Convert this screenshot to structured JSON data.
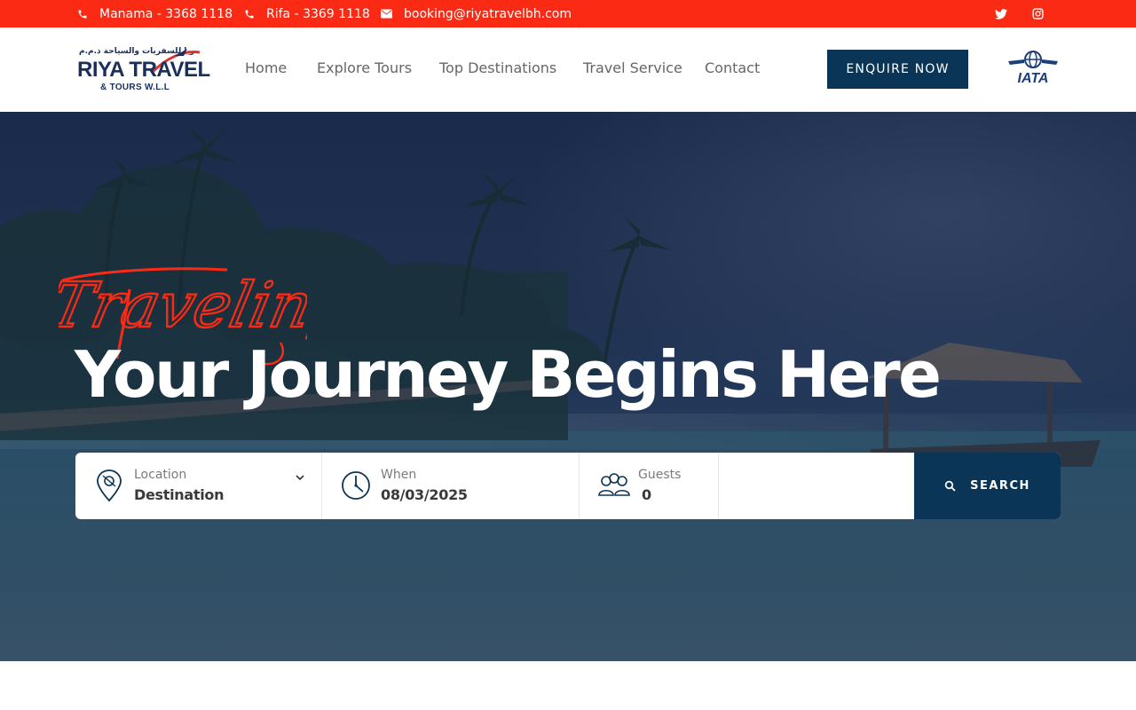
{
  "topbar": {
    "bg_color": "#fb2a14",
    "phone_manama": "Manama - 3368 1118",
    "phone_rifa": "Rifa - 3369 1118",
    "email": "booking@riyatravelbh.com",
    "social": [
      "twitter-icon",
      "instagram-icon"
    ]
  },
  "header": {
    "logo_arabic": "ريا للسفريات والسياحة ذ.م.م",
    "logo_main": "RIYA TRAVEL",
    "logo_sub": "& TOURS W.L.L",
    "nav": [
      "Home",
      "Explore Tours",
      "Top Destinations",
      "Travel Service",
      "Contact"
    ],
    "enquire_label": "ENQUIRE NOW",
    "iata_label": "IATA",
    "brand_color": "#0b3556"
  },
  "hero": {
    "script_title": "Traveling",
    "script_color": "#fb2a14",
    "headline": "Your Journey Begins Here"
  },
  "search": {
    "location_label": "Location",
    "location_value": "Destination",
    "when_label": "When",
    "when_value": "08/03/2025",
    "guests_label": "Guests",
    "guests_value": "0",
    "button_label": "SEARCH"
  }
}
